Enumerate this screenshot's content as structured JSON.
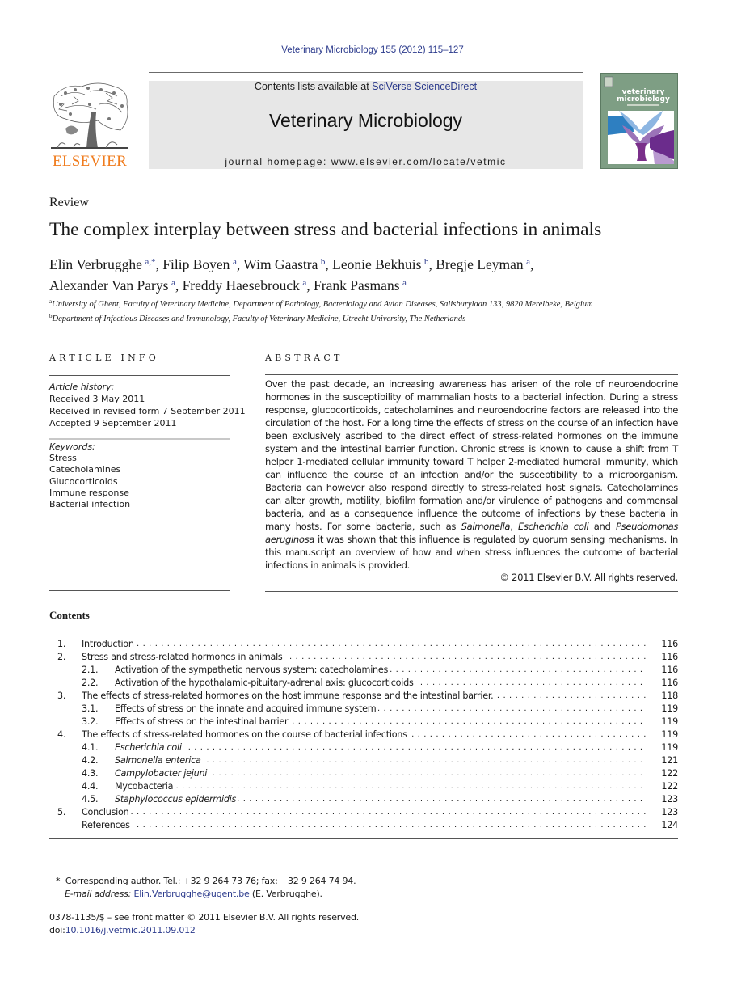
{
  "running_head": "Veterinary Microbiology 155 (2012) 115–127",
  "publisher": {
    "logo_word": "ELSEVIER",
    "logo_color": "#f07c1e"
  },
  "banner": {
    "contents_prefix": "Contents lists available at ",
    "contents_link": "SciVerse ScienceDirect",
    "journal_name": "Veterinary Microbiology",
    "homepage_prefix": "journal homepage: ",
    "homepage_url": "www.elsevier.com/locate/vetmic"
  },
  "cover": {
    "title_line1": "veterinary",
    "title_line2": "microbiology",
    "bg_color": "#7e9e84"
  },
  "article": {
    "type": "Review",
    "title": "The complex interplay between stress and bacterial infections in animals",
    "authors": [
      {
        "name": "Elin Verbrugghe",
        "affil": "a,*"
      },
      {
        "name": "Filip Boyen",
        "affil": "a"
      },
      {
        "name": "Wim Gaastra",
        "affil": "b"
      },
      {
        "name": "Leonie Bekhuis",
        "affil": "b"
      },
      {
        "name": "Bregje Leyman",
        "affil": "a"
      },
      {
        "name": "Alexander Van Parys",
        "affil": "a"
      },
      {
        "name": "Freddy Haesebrouck",
        "affil": "a"
      },
      {
        "name": "Frank Pasmans",
        "affil": "a"
      }
    ],
    "affiliations": [
      {
        "key": "a",
        "text": "University of Ghent, Faculty of Veterinary Medicine, Department of Pathology, Bacteriology and Avian Diseases, Salisburylaan 133, 9820 Merelbeke, Belgium"
      },
      {
        "key": "b",
        "text": "Department of Infectious Diseases and Immunology, Faculty of Veterinary Medicine, Utrecht University, The Netherlands"
      }
    ]
  },
  "article_info": {
    "heading": "ARTICLE INFO",
    "history_label": "Article history:",
    "history": [
      "Received 3 May 2011",
      "Received in revised form 7 September 2011",
      "Accepted 9 September 2011"
    ],
    "keywords_label": "Keywords:",
    "keywords": [
      "Stress",
      "Catecholamines",
      "Glucocorticoids",
      "Immune response",
      "Bacterial infection"
    ]
  },
  "abstract": {
    "heading": "ABSTRACT",
    "part1": "Over the past decade, an increasing awareness has arisen of the role of neuroendocrine hormones in the susceptibility of mammalian hosts to a bacterial infection. During a stress response, glucocorticoids, catecholamines and neuroendocrine factors are released into the circulation of the host. For a long time the effects of stress on the course of an infection have been exclusively ascribed to the direct effect of stress-related hormones on the immune system and the intestinal barrier function. Chronic stress is known to cause a shift from T helper 1-mediated cellular immunity toward T helper 2-mediated humoral immunity, which can influence the course of an infection and/or the susceptibility to a microorganism. Bacteria can however also respond directly to stress-related host signals. Catecholamines can alter growth, motility, biofilm formation and/or virulence of pathogens and commensal bacteria, and as a consequence influence the outcome of infections by these bacteria in many hosts. For some bacteria, such as ",
    "italic1": "Salmonella",
    "sep1": ", ",
    "italic2": "Escherichia coli",
    "sep2": " and ",
    "italic3": "Pseudomonas aeruginosa",
    "part2": " it was shown that this influence is regulated by quorum sensing mechanisms. In this manuscript an overview of how and when stress influences the outcome of bacterial infections in animals is provided.",
    "copyright": "© 2011 Elsevier B.V. All rights reserved."
  },
  "contents": {
    "heading": "Contents",
    "items": [
      {
        "num": "1.",
        "title": "Introduction",
        "page": "116",
        "level": 1,
        "italic": false
      },
      {
        "num": "2.",
        "title": "Stress and stress-related hormones in animals",
        "page": "116",
        "level": 1,
        "italic": false
      },
      {
        "num": "2.1.",
        "title": "Activation of the sympathetic nervous system: catecholamines",
        "page": "116",
        "level": 2,
        "italic": false
      },
      {
        "num": "2.2.",
        "title": "Activation of the hypothalamic-pituitary-adrenal axis: glucocorticoids",
        "page": "116",
        "level": 2,
        "italic": false
      },
      {
        "num": "3.",
        "title": "The effects of stress-related hormones on the host immune response and the intestinal barrier.",
        "page": "118",
        "level": 1,
        "italic": false
      },
      {
        "num": "3.1.",
        "title": "Effects of stress on the innate and acquired immune system",
        "page": "119",
        "level": 2,
        "italic": false
      },
      {
        "num": "3.2.",
        "title": "Effects of stress on the intestinal barrier",
        "page": "119",
        "level": 2,
        "italic": false
      },
      {
        "num": "4.",
        "title": "The effects of stress-related hormones on the course of bacterial infections",
        "page": "119",
        "level": 1,
        "italic": false
      },
      {
        "num": "4.1.",
        "title": "Escherichia coli",
        "page": "119",
        "level": 2,
        "italic": true
      },
      {
        "num": "4.2.",
        "title": "Salmonella enterica",
        "page": "121",
        "level": 2,
        "italic": true
      },
      {
        "num": "4.3.",
        "title": "Campylobacter jejuni",
        "page": "122",
        "level": 2,
        "italic": true
      },
      {
        "num": "4.4.",
        "title": "Mycobacteria",
        "page": "122",
        "level": 2,
        "italic": false
      },
      {
        "num": "4.5.",
        "title": "Staphylococcus epidermidis",
        "page": "123",
        "level": 2,
        "italic": true
      },
      {
        "num": "5.",
        "title": "Conclusion",
        "page": "123",
        "level": 1,
        "italic": false
      },
      {
        "num": "",
        "title": "References",
        "page": "124",
        "level": 1,
        "italic": false
      }
    ]
  },
  "footnote": {
    "marker": "*",
    "line1": "Corresponding author. Tel.: +32 9 264 73 76; fax: +32 9 264 74 94.",
    "email_label": "E-mail address: ",
    "email": "Elin.Verbrugghe@ugent.be",
    "email_suffix": " (E. Verbrugghe)."
  },
  "front_matter": {
    "issn_line": "0378-1135/$ – see front matter © 2011 Elsevier B.V. All rights reserved.",
    "doi_prefix": "doi:",
    "doi": "10.1016/j.vetmic.2011.09.012"
  },
  "colors": {
    "link": "#2b3a8c",
    "banner_bg": "#e7e7e7"
  }
}
